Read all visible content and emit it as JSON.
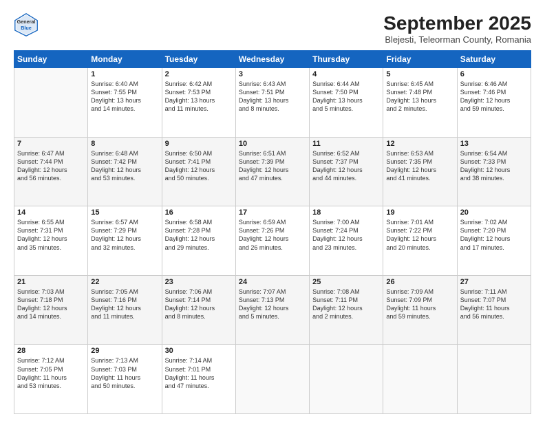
{
  "header": {
    "logo_general": "General",
    "logo_blue": "Blue",
    "month_title": "September 2025",
    "location": "Blejesti, Teleorman County, Romania"
  },
  "weekdays": [
    "Sunday",
    "Monday",
    "Tuesday",
    "Wednesday",
    "Thursday",
    "Friday",
    "Saturday"
  ],
  "weeks": [
    [
      {
        "day": "",
        "content": ""
      },
      {
        "day": "1",
        "content": "Sunrise: 6:40 AM\nSunset: 7:55 PM\nDaylight: 13 hours\nand 14 minutes."
      },
      {
        "day": "2",
        "content": "Sunrise: 6:42 AM\nSunset: 7:53 PM\nDaylight: 13 hours\nand 11 minutes."
      },
      {
        "day": "3",
        "content": "Sunrise: 6:43 AM\nSunset: 7:51 PM\nDaylight: 13 hours\nand 8 minutes."
      },
      {
        "day": "4",
        "content": "Sunrise: 6:44 AM\nSunset: 7:50 PM\nDaylight: 13 hours\nand 5 minutes."
      },
      {
        "day": "5",
        "content": "Sunrise: 6:45 AM\nSunset: 7:48 PM\nDaylight: 13 hours\nand 2 minutes."
      },
      {
        "day": "6",
        "content": "Sunrise: 6:46 AM\nSunset: 7:46 PM\nDaylight: 12 hours\nand 59 minutes."
      }
    ],
    [
      {
        "day": "7",
        "content": "Sunrise: 6:47 AM\nSunset: 7:44 PM\nDaylight: 12 hours\nand 56 minutes."
      },
      {
        "day": "8",
        "content": "Sunrise: 6:48 AM\nSunset: 7:42 PM\nDaylight: 12 hours\nand 53 minutes."
      },
      {
        "day": "9",
        "content": "Sunrise: 6:50 AM\nSunset: 7:41 PM\nDaylight: 12 hours\nand 50 minutes."
      },
      {
        "day": "10",
        "content": "Sunrise: 6:51 AM\nSunset: 7:39 PM\nDaylight: 12 hours\nand 47 minutes."
      },
      {
        "day": "11",
        "content": "Sunrise: 6:52 AM\nSunset: 7:37 PM\nDaylight: 12 hours\nand 44 minutes."
      },
      {
        "day": "12",
        "content": "Sunrise: 6:53 AM\nSunset: 7:35 PM\nDaylight: 12 hours\nand 41 minutes."
      },
      {
        "day": "13",
        "content": "Sunrise: 6:54 AM\nSunset: 7:33 PM\nDaylight: 12 hours\nand 38 minutes."
      }
    ],
    [
      {
        "day": "14",
        "content": "Sunrise: 6:55 AM\nSunset: 7:31 PM\nDaylight: 12 hours\nand 35 minutes."
      },
      {
        "day": "15",
        "content": "Sunrise: 6:57 AM\nSunset: 7:29 PM\nDaylight: 12 hours\nand 32 minutes."
      },
      {
        "day": "16",
        "content": "Sunrise: 6:58 AM\nSunset: 7:28 PM\nDaylight: 12 hours\nand 29 minutes."
      },
      {
        "day": "17",
        "content": "Sunrise: 6:59 AM\nSunset: 7:26 PM\nDaylight: 12 hours\nand 26 minutes."
      },
      {
        "day": "18",
        "content": "Sunrise: 7:00 AM\nSunset: 7:24 PM\nDaylight: 12 hours\nand 23 minutes."
      },
      {
        "day": "19",
        "content": "Sunrise: 7:01 AM\nSunset: 7:22 PM\nDaylight: 12 hours\nand 20 minutes."
      },
      {
        "day": "20",
        "content": "Sunrise: 7:02 AM\nSunset: 7:20 PM\nDaylight: 12 hours\nand 17 minutes."
      }
    ],
    [
      {
        "day": "21",
        "content": "Sunrise: 7:03 AM\nSunset: 7:18 PM\nDaylight: 12 hours\nand 14 minutes."
      },
      {
        "day": "22",
        "content": "Sunrise: 7:05 AM\nSunset: 7:16 PM\nDaylight: 12 hours\nand 11 minutes."
      },
      {
        "day": "23",
        "content": "Sunrise: 7:06 AM\nSunset: 7:14 PM\nDaylight: 12 hours\nand 8 minutes."
      },
      {
        "day": "24",
        "content": "Sunrise: 7:07 AM\nSunset: 7:13 PM\nDaylight: 12 hours\nand 5 minutes."
      },
      {
        "day": "25",
        "content": "Sunrise: 7:08 AM\nSunset: 7:11 PM\nDaylight: 12 hours\nand 2 minutes."
      },
      {
        "day": "26",
        "content": "Sunrise: 7:09 AM\nSunset: 7:09 PM\nDaylight: 11 hours\nand 59 minutes."
      },
      {
        "day": "27",
        "content": "Sunrise: 7:11 AM\nSunset: 7:07 PM\nDaylight: 11 hours\nand 56 minutes."
      }
    ],
    [
      {
        "day": "28",
        "content": "Sunrise: 7:12 AM\nSunset: 7:05 PM\nDaylight: 11 hours\nand 53 minutes."
      },
      {
        "day": "29",
        "content": "Sunrise: 7:13 AM\nSunset: 7:03 PM\nDaylight: 11 hours\nand 50 minutes."
      },
      {
        "day": "30",
        "content": "Sunrise: 7:14 AM\nSunset: 7:01 PM\nDaylight: 11 hours\nand 47 minutes."
      },
      {
        "day": "",
        "content": ""
      },
      {
        "day": "",
        "content": ""
      },
      {
        "day": "",
        "content": ""
      },
      {
        "day": "",
        "content": ""
      }
    ]
  ]
}
